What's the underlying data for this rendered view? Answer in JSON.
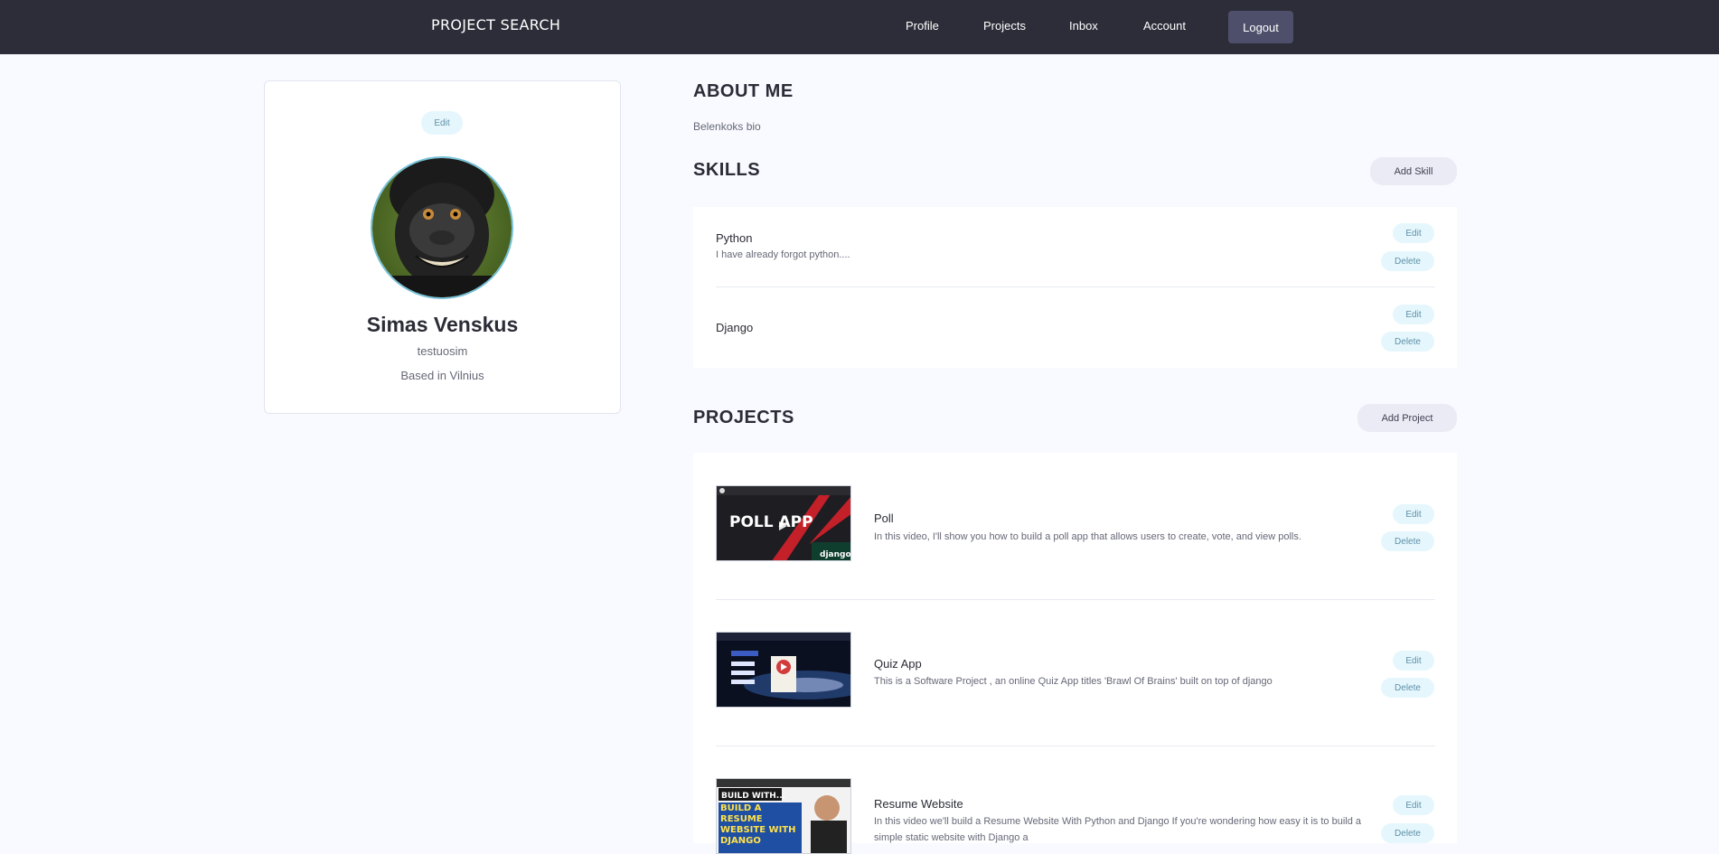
{
  "navbar": {
    "brand": "PROJECT SEARCH",
    "links": [
      "Profile",
      "Projects",
      "Inbox",
      "Account"
    ],
    "logout": "Logout"
  },
  "profile": {
    "edit_label": "Edit",
    "name": "Simas Venskus",
    "username": "testuosim",
    "location": "Based in Vilnius",
    "avatar": "macaque-selfie-avatar"
  },
  "about": {
    "title": "ABOUT ME",
    "bio": "Belenkoks bio"
  },
  "skills": {
    "title": "SKILLS",
    "add_label": "Add Skill",
    "edit_label": "Edit",
    "delete_label": "Delete",
    "items": [
      {
        "name": "Python",
        "description": "I have already forgot python...."
      },
      {
        "name": "Django",
        "description": ""
      }
    ]
  },
  "projects": {
    "title": "PROJECTS",
    "add_label": "Add Project",
    "edit_label": "Edit",
    "delete_label": "Delete",
    "items": [
      {
        "title": "Poll",
        "description": "In this video, I'll show you how to build a poll app that allows users to create, vote, and view polls.",
        "thumb_text": "POLL APP",
        "thumb_sub": "django"
      },
      {
        "title": "Quiz App",
        "description": "This is a Software Project , an online Quiz App titles 'Brawl Of Brains' built on top of django",
        "thumb_text": "",
        "thumb_sub": ""
      },
      {
        "title": "Resume Website",
        "description": "In this video we'll build a Resume Website With Python and Django If you're wondering how easy it is to build a simple static website with Django a",
        "thumb_text": "BUILD A RESUME WEBSITE WITH DJANGO",
        "thumb_sub": "BUILD WITH..."
      }
    ]
  },
  "colors": {
    "navbar": "#2d2d39",
    "background": "#f8faff",
    "sub_pill": "#e5f7fd",
    "main_pill": "#ebebf5"
  }
}
